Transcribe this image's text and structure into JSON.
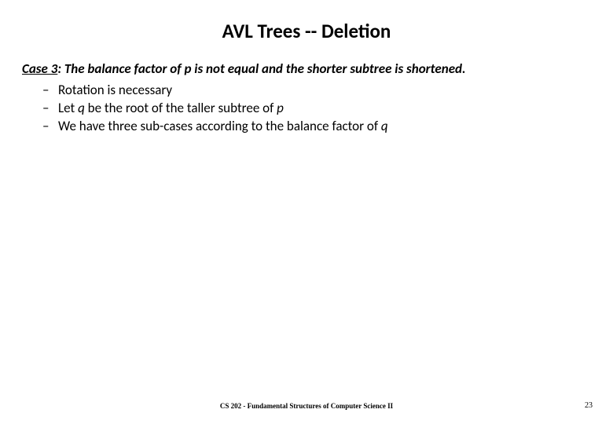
{
  "title": "AVL Trees -- Deletion",
  "case": {
    "label": "Case 3",
    "description_prefix": ": The balance factor of ",
    "var1": "p",
    "description_suffix": " is not equal and the shorter subtree is shortened."
  },
  "bullets": {
    "b1": "Rotation is necessary",
    "b2_a": "Let ",
    "b2_q": "q",
    "b2_b": " be the root of the taller subtree of ",
    "b2_p": "p",
    "b3_a": "We have three sub-cases according to the balance factor of ",
    "b3_q": "q"
  },
  "footer": {
    "center": "CS 202 - Fundamental Structures of Computer Science II",
    "page": "23"
  }
}
